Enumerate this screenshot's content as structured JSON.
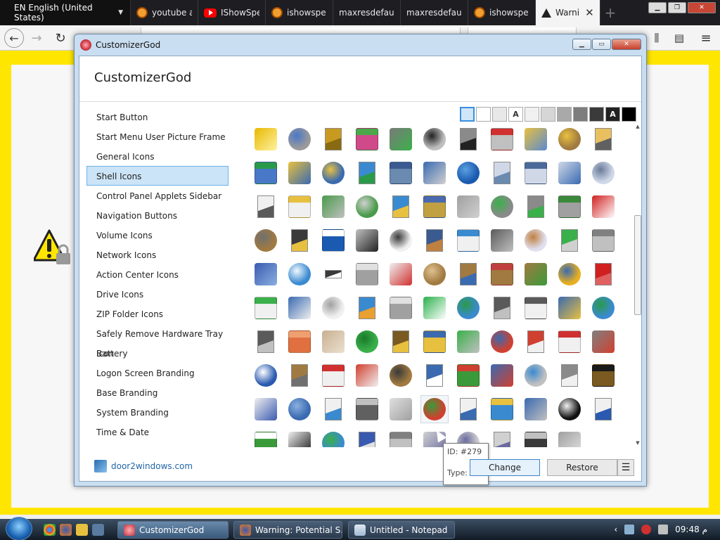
{
  "browser": {
    "language_selector": "EN English (United States)",
    "tabs": [
      {
        "title": "youtube a",
        "favicon": "site-icon"
      },
      {
        "title": "IShowSpe",
        "favicon": "youtube-icon"
      },
      {
        "title": "ishowspe",
        "favicon": "site-icon"
      },
      {
        "title": "maxresdefault",
        "favicon": "none"
      },
      {
        "title": "maxresdefault",
        "favicon": "none"
      },
      {
        "title": "ishowspe",
        "favicon": "site-icon"
      },
      {
        "title": "Warni",
        "favicon": "warning-icon",
        "active": true
      }
    ],
    "new_tab_glyph": "+",
    "nav": {
      "back": "←",
      "forward": "→",
      "reload": "↻"
    }
  },
  "customizer": {
    "window_title": "CustomizerGod",
    "header": "CustomizerGod",
    "menu": [
      {
        "label": "Start Button"
      },
      {
        "label": "Start Menu User Picture Frame"
      },
      {
        "label": "General Icons"
      },
      {
        "label": "Shell Icons",
        "selected": true
      },
      {
        "label": "Control Panel Applets Sidebar"
      },
      {
        "label": "Navigation Buttons"
      },
      {
        "label": "Volume Icons"
      },
      {
        "label": "Network Icons"
      },
      {
        "label": "Action Center Icons"
      },
      {
        "label": "Drive Icons"
      },
      {
        "label": "ZIP Folder Icons"
      },
      {
        "label": "Safely Remove Hardware Tray Icon"
      },
      {
        "label": "Battery"
      },
      {
        "label": "Logon Screen Branding"
      },
      {
        "label": "Base Branding"
      },
      {
        "label": "System Branding"
      },
      {
        "label": "Time & Date"
      }
    ],
    "background_swatches": [
      {
        "color": "#cfe5f8",
        "text": ""
      },
      {
        "color": "#ffffff",
        "text": ""
      },
      {
        "color": "#e8e8e8",
        "text": ""
      },
      {
        "color": "#ffffff",
        "text": "A"
      },
      {
        "color": "#f0f0f0",
        "text": ""
      },
      {
        "color": "#d6d6d6",
        "text": ""
      },
      {
        "color": "#a9a9a9",
        "text": ""
      },
      {
        "color": "#7d7d7d",
        "text": ""
      },
      {
        "color": "#3a3a3a",
        "text": ""
      },
      {
        "color": "#222222",
        "text": "A"
      },
      {
        "color": "#000000",
        "text": ""
      }
    ],
    "tooltip": {
      "id": "ID: #279",
      "type": "Type: ICO"
    },
    "footer": {
      "link": "door2windows.com",
      "change": "Change",
      "restore": "Restore",
      "more": "☰"
    },
    "icon_rows": [
      [
        [
          "#e8b800",
          "#fff2a0"
        ],
        [
          "#9a9a9a",
          "#4a78c8"
        ],
        [
          "#c89a20",
          "#8a6a10"
        ],
        [
          "#d04a8a",
          "#4aa84a"
        ],
        [
          "#7a7a7a",
          "#3ab04a"
        ],
        [
          "#bfbfbf",
          "#222222"
        ],
        [
          "#8a8a8a",
          "#222222"
        ],
        [
          "#c0c0c0",
          "#d03030"
        ],
        [
          "#e8c040",
          "#5a8ad0"
        ],
        [
          "#a07a40",
          "#e8c040"
        ],
        [
          "#e8c060",
          "#606060"
        ]
      ],
      [
        [
          "#4a78c8",
          "#2a9a4a"
        ],
        [
          "#e8c040",
          "#3a6ab0"
        ],
        [
          "#3a6ab0",
          "#e8c040"
        ],
        [
          "#3a8ad0",
          "#2a9a4a"
        ],
        [
          "#6a8ab0",
          "#3a5a90"
        ],
        [
          "#3a6ab0",
          "#d0d0d0"
        ],
        [
          "#1a5ab0",
          "#5aa0e0"
        ],
        [
          "#d0d8e8",
          "#6a8ab0"
        ],
        [
          "#d0d8e8",
          "#4a6a9a"
        ],
        [
          "#d0d8e8",
          "#3a6ab0"
        ],
        [
          "#d0d8e8",
          "#6a7a9a"
        ]
      ],
      [
        [
          "#f0f0f0",
          "#5a5a5a"
        ],
        [
          "#f0f0f0",
          "#e8c040"
        ],
        [
          "#4a9a4a",
          "#c0c0c0"
        ],
        [
          "#4a9a4a",
          "#d0d0d0"
        ],
        [
          "#3a8ad0",
          "#e8c040"
        ],
        [
          "#c0a040",
          "#4a6ab0"
        ],
        [
          "#a0a0a0",
          "#d0d0d0"
        ],
        [
          "#8a8a8a",
          "#3ab04a"
        ],
        [
          "#8a8a8a",
          "#3ab04a"
        ],
        [
          "#a0a0a0",
          "#3a8a3a"
        ],
        [
          "#d02020",
          "#ffffff"
        ]
      ],
      [
        [
          "#a07a40",
          "#707070"
        ],
        [
          "#3a3a3a",
          "#e8c040"
        ],
        [
          "#1a5ab0",
          "#ffffff"
        ],
        [
          "#c0c0c0",
          "#222222"
        ],
        [
          "#f0f0f0",
          "#3a3a3a"
        ],
        [
          "#3a5a90",
          "#c08040"
        ],
        [
          "#f0f0f0",
          "#3a8ad0"
        ],
        [
          "#5a5a5a",
          "#c0c0c0"
        ],
        [
          "#e0e0f0",
          "#c08040"
        ],
        [
          "#3ab04a",
          "#d0d0d0"
        ],
        [
          "#c0c0c0",
          "#808080"
        ]
      ],
      [
        [
          "#3a5ab0",
          "#8ab0e0"
        ],
        [
          "#3a8ad0",
          "#f0f8ff"
        ],
        [
          "#3a3a3a",
          "#ffffff"
        ],
        [
          "#a0a0a0",
          "#e0e0e0"
        ],
        [
          "#f0f0f0",
          "#d03030"
        ],
        [
          "#a07a40",
          "#e0c090"
        ],
        [
          "#a07a40",
          "#3a6ab0"
        ],
        [
          "#a07a40",
          "#c04040"
        ],
        [
          "#a07a40",
          "#3a9a3a"
        ],
        [
          "#e8b020",
          "#3a6ab0"
        ],
        [
          "#d02020",
          "#e06060"
        ]
      ],
      [
        [
          "#f0f0f0",
          "#3ab04a"
        ],
        [
          "#3a6ab0",
          "#f0f0f0"
        ],
        [
          "#f0f0f0",
          "#a0a0a0"
        ],
        [
          "#3a8ad0",
          "#e8a030"
        ],
        [
          "#a0a0a0",
          "#e0e0e0"
        ],
        [
          "#2ab04a",
          "#ffffff"
        ],
        [
          "#3a8ad0",
          "#2a9a4a"
        ],
        [
          "#5a5a5a",
          "#c0c0c0"
        ],
        [
          "#f0f0f0",
          "#5a5a5a"
        ],
        [
          "#3a6ab0",
          "#e8c040"
        ],
        [
          "#3a8ad0",
          "#2a9a4a"
        ]
      ],
      [
        [
          "#5a5a5a",
          "#c0c0c0"
        ],
        [
          "#e07040",
          "#f0a070"
        ],
        [
          "#c8b090",
          "#ece0d0"
        ],
        [
          "#3ab04a",
          "#1a7a2a"
        ],
        [
          "#7a5a20",
          "#e8c040"
        ],
        [
          "#e8c040",
          "#3a6ab0"
        ],
        [
          "#3ab04a",
          "#c0c0c0"
        ],
        [
          "#d04030",
          "#3a6ab0"
        ],
        [
          "#d04030",
          "#f0f0f0"
        ],
        [
          "#f0f0f0",
          "#d03030"
        ],
        [
          "#808080",
          "#d04030"
        ]
      ],
      [
        [
          "#2a5ab0",
          "#ffffff"
        ],
        [
          "#a07a40",
          "#707070"
        ],
        [
          "#f0f0f0",
          "#d03030"
        ],
        [
          "#d04030",
          "#f0f0f0"
        ],
        [
          "#a07a40",
          "#3a3a3a"
        ],
        [
          "#3a6ab0",
          "#ffffff"
        ],
        [
          "#3a9a3a",
          "#d04030"
        ],
        [
          "#3a6ab0",
          "#d04030"
        ],
        [
          "#c0c0c0",
          "#3a8ad0"
        ],
        [
          "#8a8a8a",
          "#f0f0f0"
        ],
        [
          "#7a5a20",
          "#1a1a1a"
        ]
      ],
      [
        [
          "#f0f0f0",
          "#3a5ab0"
        ],
        [
          "#3a6ab0",
          "#8ab0e0"
        ],
        [
          "#f0f0f0",
          "#3a8ad0"
        ],
        [
          "#606060",
          "#c0c0c0"
        ],
        [
          "#e0e0e0",
          "#a0a0a0"
        ],
        [
          "#d04030",
          "#3a9a3a"
        ],
        [
          "#f0f0f0",
          "#3a6ab0"
        ],
        [
          "#3a8ad0",
          "#e8c040"
        ],
        [
          "#3a6ab0",
          "#c0c0c0"
        ],
        [
          "#111111",
          "#f0f0f0"
        ],
        [
          "#f0f0f0",
          "#2a5ab0"
        ]
      ],
      [
        [
          "#3a9a3a",
          "#ffffff"
        ],
        [
          "#f0f0f0",
          "#1a1a1a"
        ],
        [
          "#3a8ad0",
          "#3ab04a"
        ],
        [
          "#3a5ab0",
          "#e0e0e0"
        ],
        [
          "#c0c0c0",
          "#808080"
        ],
        [
          "#d0d0d0",
          "#6a6aa0"
        ],
        [
          "#d0d0d0",
          "#6a6aa0"
        ],
        [
          "#d0d0d0",
          "#6a6aa0"
        ],
        [
          "#3a3a3a",
          "#c0c0c0"
        ],
        [
          "#a0a0a0",
          "#e0e0e0"
        ]
      ]
    ]
  },
  "taskbar": {
    "items": [
      {
        "label": "CustomizerGod",
        "icon": "customizer-icon"
      },
      {
        "label": "Warning: Potential S...",
        "icon": "firefox-icon"
      },
      {
        "label": "Untitled - Notepad",
        "icon": "notepad-icon"
      }
    ],
    "clock": "09:48 م"
  }
}
